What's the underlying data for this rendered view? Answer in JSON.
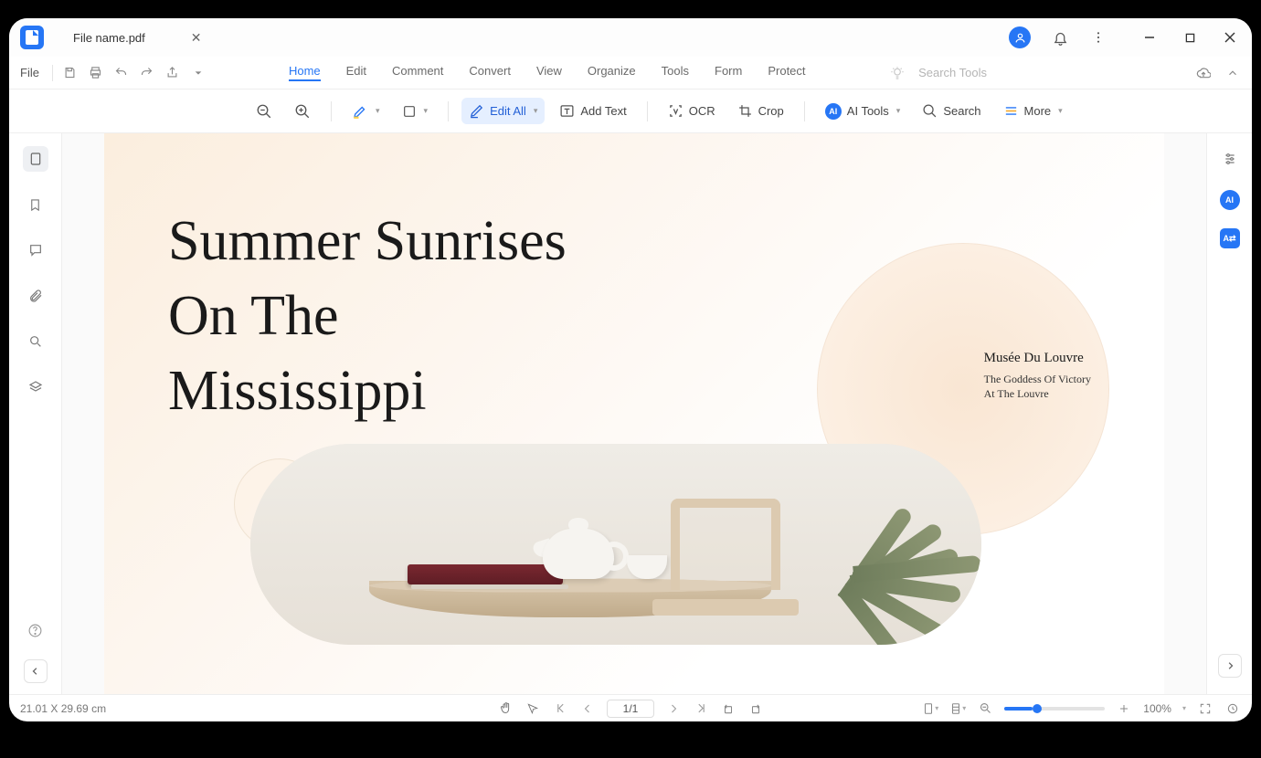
{
  "titlebar": {
    "filename": "File name.pdf"
  },
  "menubar": {
    "file": "File",
    "tabs": [
      "Home",
      "Edit",
      "Comment",
      "Convert",
      "View",
      "Organize",
      "Tools",
      "Form",
      "Protect"
    ],
    "active_tab": "Home",
    "search_placeholder": "Search Tools"
  },
  "toolbar": {
    "edit_all": "Edit All",
    "add_text": "Add Text",
    "ocr": "OCR",
    "crop": "Crop",
    "ai_tools": "AI Tools",
    "search": "Search",
    "more": "More"
  },
  "document": {
    "title_line1": "Summer Sunrises",
    "title_line2": "On The",
    "title_line3": "Mississippi",
    "side_heading": "Musée Du Louvre",
    "side_body_line1": "The Goddess Of Victory",
    "side_body_line2": "At The Louvre"
  },
  "statusbar": {
    "dimensions": "21.01 X 29.69 cm",
    "page": "1/1",
    "zoom": "100%"
  }
}
